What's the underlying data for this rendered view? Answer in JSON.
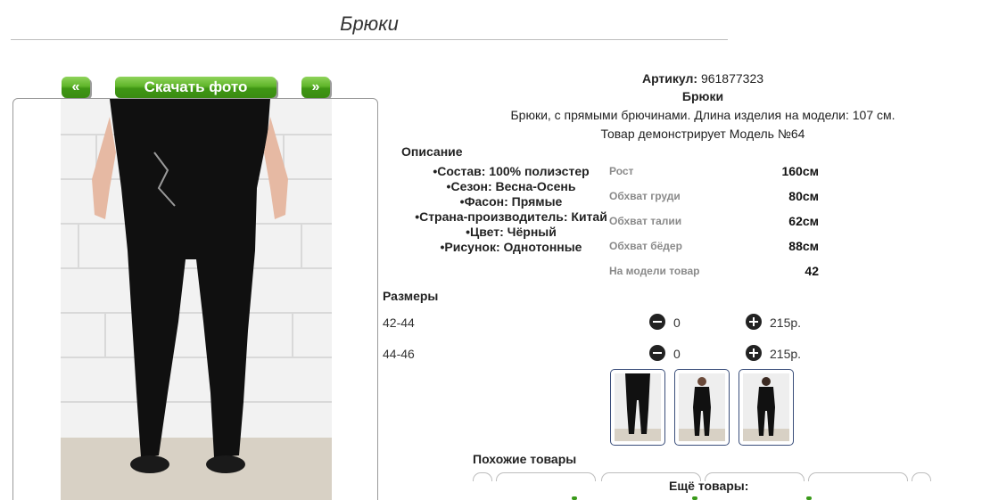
{
  "page": {
    "title": "Брюки"
  },
  "buttons": {
    "prev": "«",
    "download": "Скачать фото",
    "next": "»"
  },
  "product": {
    "article_label": "Артикул:",
    "article_value": " 961877323",
    "name": "Брюки",
    "description": "Брюки, с прямыми брючинами. Длина изделия на модели: 107 см.",
    "model_line": "Товар демонстрирует Модель №64"
  },
  "description_section": {
    "heading": "Описание",
    "items": [
      "Состав: 100% полиэстер",
      "Сезон: Весна-Осень",
      "Фасон: Прямые",
      "Страна-производитель: Китай",
      "Цвет: Чёрный",
      "Рисунок: Однотонные"
    ]
  },
  "model_params": [
    {
      "label": "Рост",
      "value": "160см"
    },
    {
      "label": "Обхват груди",
      "value": "80см"
    },
    {
      "label": "Обхват талии",
      "value": "62см"
    },
    {
      "label": "Обхват бёдер",
      "value": "88см"
    },
    {
      "label": "На модели товар",
      "value": "42"
    }
  ],
  "sizes": {
    "heading": "Размеры",
    "rows": [
      {
        "size": "42-44",
        "qty": "0",
        "price": "215р."
      },
      {
        "size": "44-46",
        "qty": "0",
        "price": "215р."
      }
    ]
  },
  "similar": {
    "heading": "Похожие товары"
  },
  "more": {
    "heading": "Ещё товары:"
  },
  "colors": {
    "accent_green": "#4ca61f",
    "thumb_border": "#3a4e7a"
  }
}
